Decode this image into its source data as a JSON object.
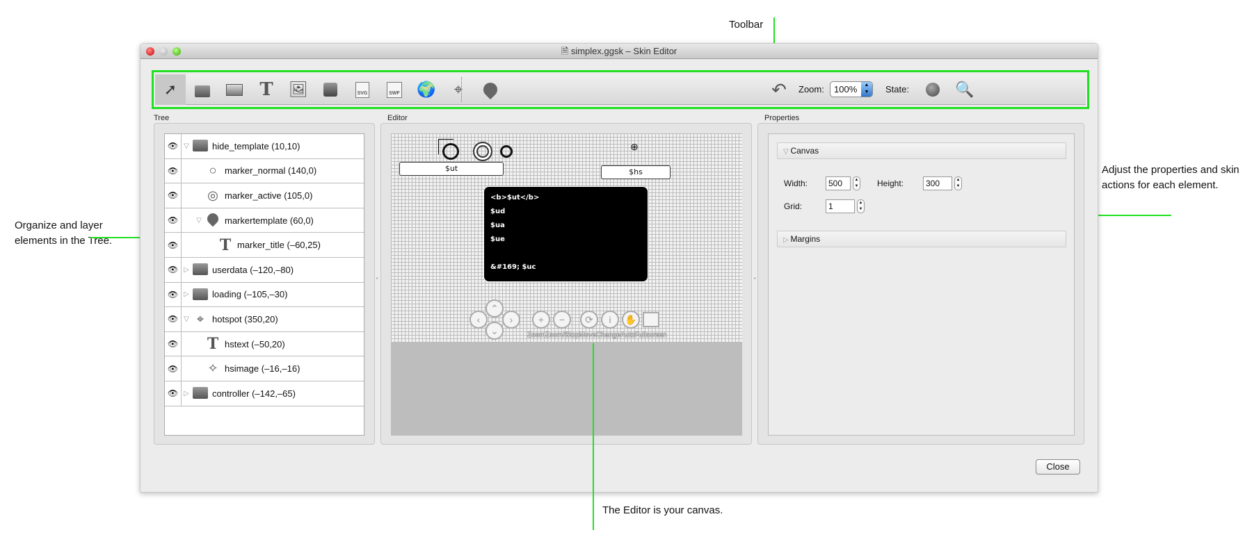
{
  "window": {
    "title": "simplex.ggsk – Skin Editor"
  },
  "toolbar": {
    "tools": [
      "select-tool",
      "container-tool",
      "rectangle-tool",
      "text-tool",
      "image-tool",
      "button-tool",
      "svg-tool",
      "swf-tool",
      "map-tool",
      "hotspot-tool",
      "marker-tool"
    ],
    "svg_label": "SVG",
    "swf_label": "SWF",
    "zoom_label": "Zoom:",
    "zoom_value": "100%",
    "state_label": "State:"
  },
  "tree": {
    "label": "Tree",
    "items": [
      {
        "name": "hide_template (10,10)",
        "icon": "folder",
        "expand": "open",
        "indent": 0
      },
      {
        "name": "marker_normal (140,0)",
        "icon": "ring",
        "expand": "",
        "indent": 1
      },
      {
        "name": "marker_active (105,0)",
        "icon": "double-ring",
        "expand": "",
        "indent": 1
      },
      {
        "name": "markertemplate (60,0)",
        "icon": "marker",
        "expand": "open",
        "indent": 1
      },
      {
        "name": "marker_title (–60,25)",
        "icon": "text",
        "expand": "",
        "indent": 2
      },
      {
        "name": "userdata (–120,–80)",
        "icon": "folder",
        "expand": "closed",
        "indent": 0
      },
      {
        "name": "loading (–105,–30)",
        "icon": "folder",
        "expand": "closed",
        "indent": 0
      },
      {
        "name": "hotspot (350,20)",
        "icon": "hotspot",
        "expand": "open",
        "indent": 0
      },
      {
        "name": "hstext (–50,20)",
        "icon": "text",
        "expand": "",
        "indent": 1
      },
      {
        "name": "hsimage (–16,–16)",
        "icon": "hsimage",
        "expand": "",
        "indent": 1
      },
      {
        "name": "controller (–142,–65)",
        "icon": "folder",
        "expand": "closed",
        "indent": 0
      }
    ]
  },
  "editor": {
    "label": "Editor",
    "ut_label": "$ut",
    "hs_label": "$hs",
    "info_lines": [
      "<b>$ut</b>",
      "$ud",
      "$ua",
      "$ue",
      "",
      "&#169; $uc"
    ],
    "controller_text": "ZoomZoom/StopMoveChangeAutoFullscreen"
  },
  "properties": {
    "label": "Properties",
    "canvas_section": "Canvas",
    "width_label": "Width:",
    "width_value": "500",
    "height_label": "Height:",
    "height_value": "300",
    "grid_label": "Grid:",
    "grid_value": "1",
    "margins_section": "Margins"
  },
  "close_label": "Close",
  "annotations": {
    "toolbar": "Toolbar",
    "tree": "Organize and layer elements in the Tree.",
    "properties": "Adjust the properties and skin actions for each element.",
    "editor": "The Editor is your canvas."
  },
  "colors": {
    "annotation": "#20e020"
  }
}
